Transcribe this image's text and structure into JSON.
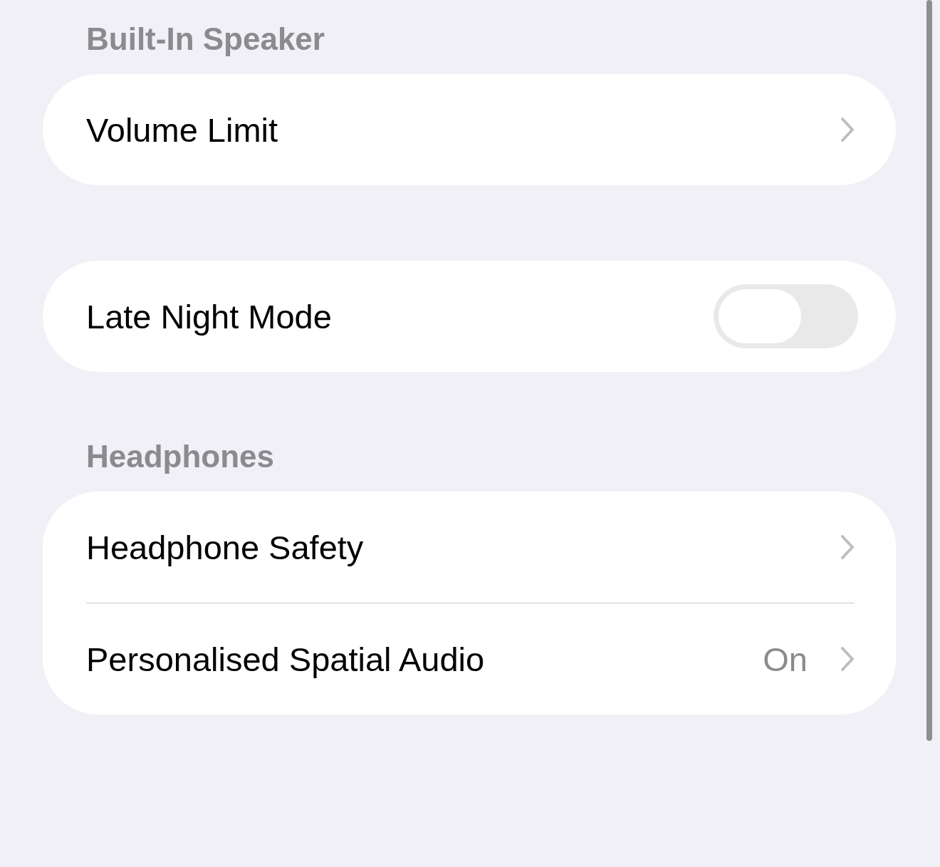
{
  "sections": [
    {
      "header": "Built-In Speaker",
      "rows": [
        {
          "kind": "link",
          "label": "Volume Limit"
        }
      ]
    },
    {
      "rows": [
        {
          "kind": "toggle",
          "label": "Late Night Mode",
          "on": false
        }
      ]
    },
    {
      "header": "Headphones",
      "rows": [
        {
          "kind": "link",
          "label": "Headphone Safety"
        },
        {
          "kind": "link",
          "label": "Personalised Spatial Audio",
          "value": "On"
        }
      ]
    }
  ]
}
